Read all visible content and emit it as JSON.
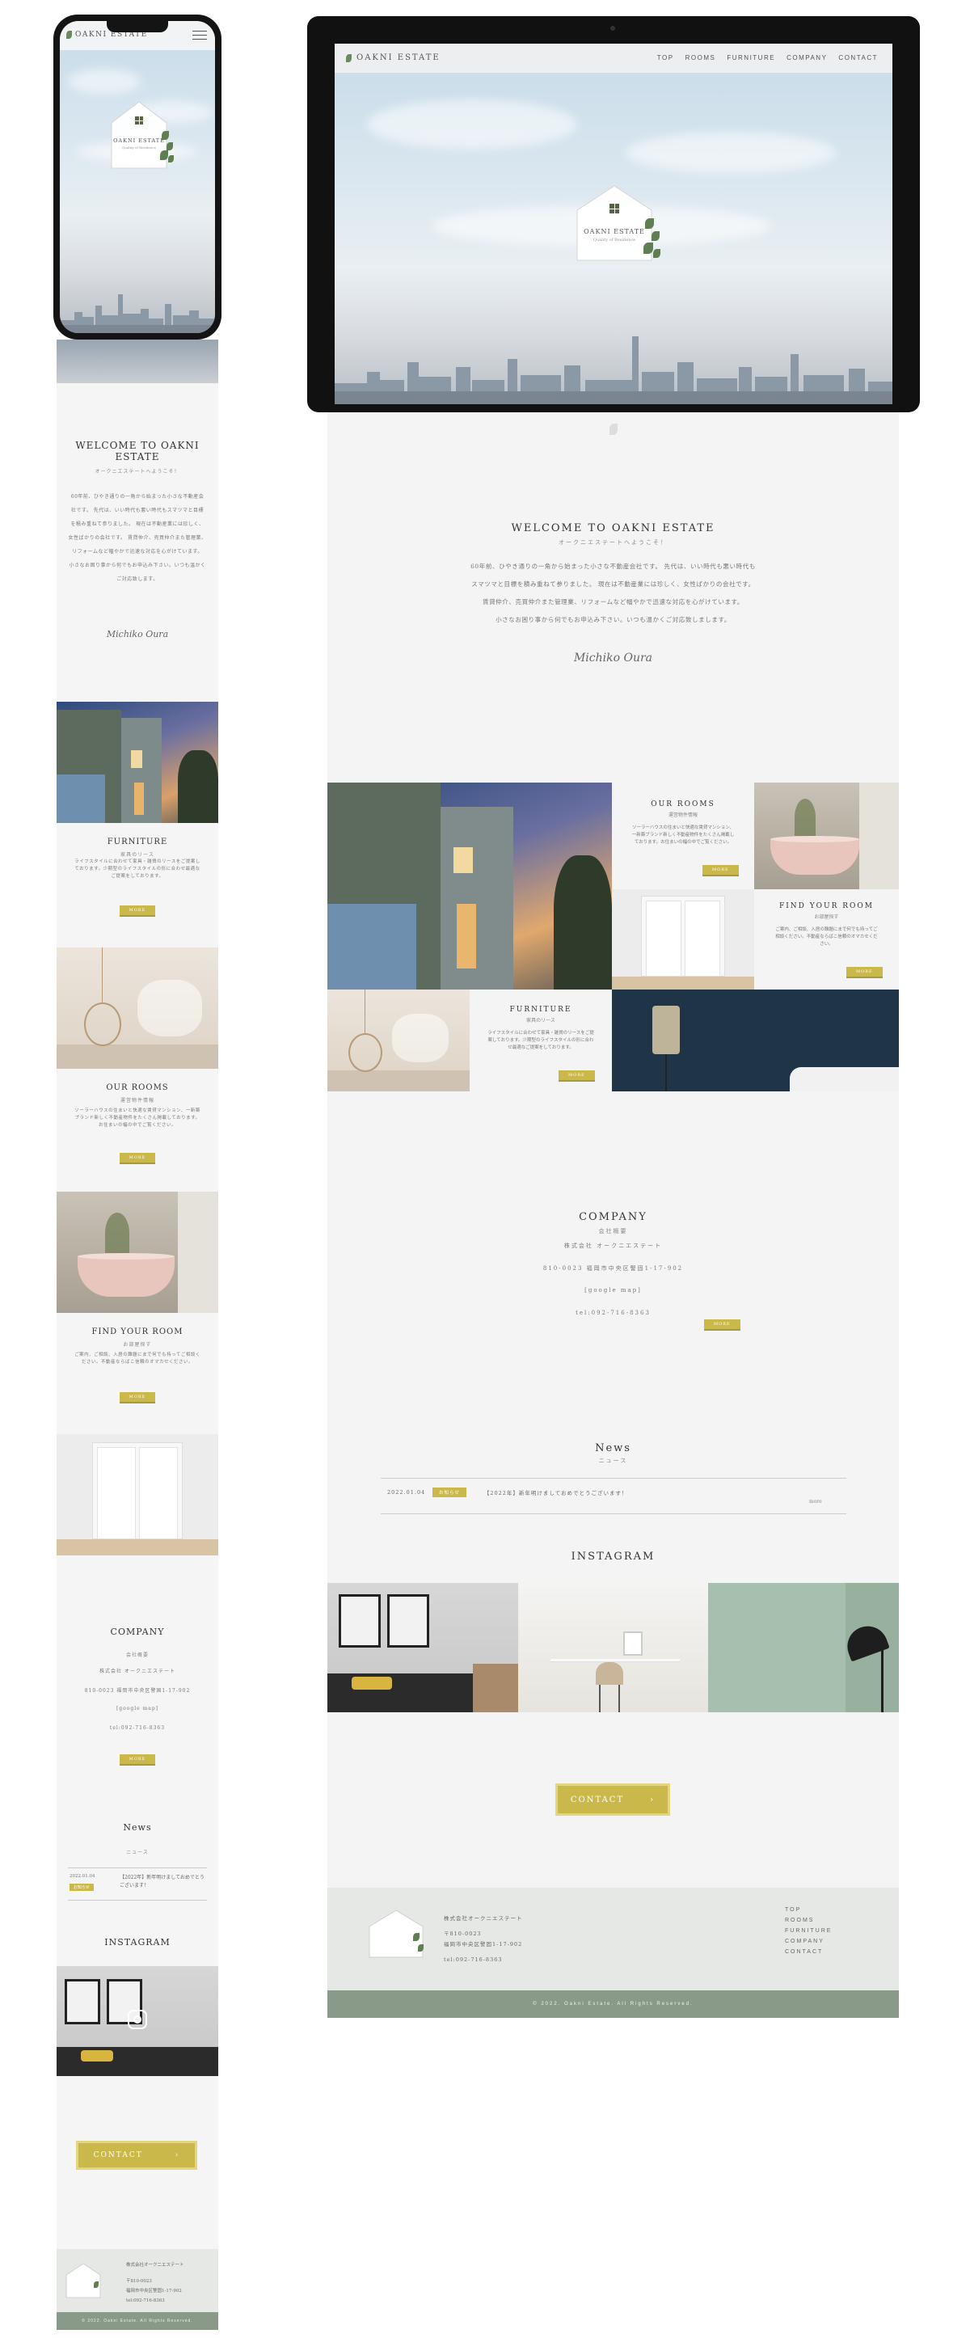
{
  "brand": {
    "name": "OAKNI ESTATE",
    "house_name": "OAKNI ESTATE",
    "house_tagline": "Quality of Residence"
  },
  "nav": {
    "items": [
      "TOP",
      "ROOMS",
      "FURNITURE",
      "COMPANY",
      "CONTACT"
    ]
  },
  "welcome": {
    "title": "WELCOME TO OAKNI ESTATE",
    "subtitle": "オークニエステートへようこそ！",
    "body_lines_desktop": [
      "60年前、ひやき通りの一角から始まった小さな不動産会社です。 先代は、いい時代も悪い時代も",
      "スマツマと目標を積み重ねて参りました。 現在は不動産業には珍しく、女性ばかりの会社です。",
      "賃貸仲介、売買仲介また管理業、リフォームなど幅やかで迅速な対応を心がけています。",
      "小さなお困り事から何でもお申込み下さい。いつも温かくご対応致しまします。"
    ],
    "body_lines_mobile": [
      "60年前、ひやき通りの一角から始まった小さな不動産会",
      "社です。 先代は、いい時代も悪い時代もスマツマと目標",
      "を積み重ねて参りました。 現在は不動産業には珍しく、",
      "女性ばかりの会社です。 賃貸仲介、売買仲介また管理業、",
      "リフォームなど幅やかで迅速な対応を心がけています。",
      "小さなお困り事から何でもお申込み下さい。いつも温かく",
      "ご対応致します。"
    ],
    "signature": "Michiko Oura"
  },
  "tiles": {
    "rooms": {
      "title": "OUR ROOMS",
      "subtitle": "運営物件情報",
      "body": "ソーラーハウスの住まいと快適な賃貸マンション、一新築ブランド新しく不動産物件をたくさん掲載しております。お住まいの幅の中でご覧ください。"
    },
    "find": {
      "title": "FIND YOUR ROOM",
      "subtitle": "お部屋探す",
      "body": "ご案内、ご相談、入居の難題にまで何でも持ってご相談ください。不動産ならばこ信頼のオマカセください。"
    },
    "furniture": {
      "title": "FURNITURE",
      "subtitle": "家具のリース",
      "body": "ライフスタイルに合わせて家具・雑貨のリースをご提案しております。少期型のライフスタイルの形に合わせ最適なご提案をしております。"
    },
    "more_label": "MORE"
  },
  "company": {
    "title": "COMPANY",
    "subtitle": "会社概要",
    "name": "株式会社 オークニエステート",
    "address": "810-0023 福岡市中央区警固1-17-902",
    "map": "[google map]",
    "tel": "tel:092-716-8363",
    "more_label": "MORE"
  },
  "news": {
    "title": "News",
    "subtitle": "ニュース",
    "items": [
      {
        "date": "2022.01.04",
        "tag": "お知らせ",
        "text": "【2022年】新年明けましておめでとうございます！"
      }
    ],
    "more": "more"
  },
  "instagram": {
    "title": "INSTAGRAM"
  },
  "contact": {
    "label": "CONTACT",
    "arrow": "›"
  },
  "footer": {
    "company": "株式会社オークニエステート",
    "zip": "〒810-0023",
    "address": "福岡市中央区警固1-17-902",
    "tel": "tel:092-716-8363",
    "links": [
      "TOP",
      "ROOMS",
      "FURNITURE",
      "COMPANY",
      "CONTACT"
    ],
    "copyright": "© 2022. Oakni Estate. All Rights Reserved."
  },
  "colors": {
    "accent": "#cbb84a",
    "footer_band": "#8a9a89",
    "page_bg": "#f4f4f4"
  },
  "icons": {
    "menu": "hamburger-icon",
    "instagram": "instagram-icon",
    "leaf": "leaf-icon"
  }
}
